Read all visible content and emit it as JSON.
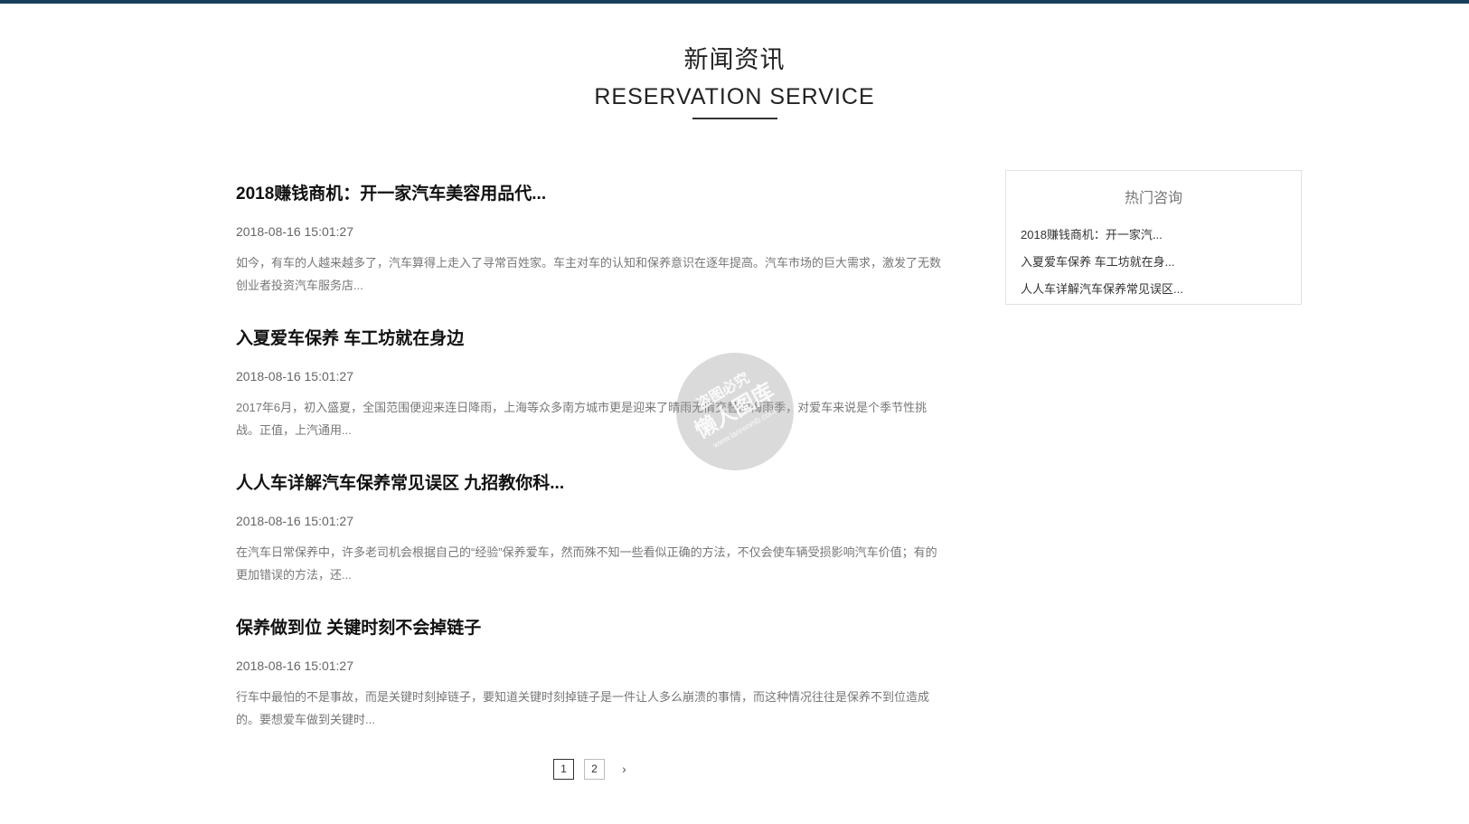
{
  "header": {
    "title": "新闻资讯",
    "subtitle": "RESERVATION SERVICE"
  },
  "news": [
    {
      "title": "2018赚钱商机：开一家汽车美容用品代...",
      "date": "2018-08-16 15:01:27",
      "summary_line1": "如今，有车的人越来越多了，汽车算得上走入了寻常百姓家。车主对车的认知和保养意识在逐年提高。汽车市场的巨大需求，激发了无数",
      "summary_line2": "创业者投资汽车服务店..."
    },
    {
      "title": "入夏爱车保养 车工坊就在身边",
      "date": "2018-08-16 15:01:27",
      "summary_line1": "2017年6月，初入盛夏，全国范围便迎来连日降雨，上海等众多南方城市更是迎来了晴雨无情交替的梅雨季，对爱车来说是个季节性挑",
      "summary_line2": "战。正值，上汽通用..."
    },
    {
      "title": "人人车详解汽车保养常见误区 九招教你科...",
      "date": "2018-08-16 15:01:27",
      "summary_line1": "在汽车日常保养中，许多老司机会根据自己的“经验”保养爱车，然而殊不知一些看似正确的方法，不仅会使车辆受损影响汽车价值；有的",
      "summary_line2": "更加错误的方法，还..."
    },
    {
      "title": "保养做到位 关键时刻不会掉链子",
      "date": "2018-08-16 15:01:27",
      "summary_line1": "行车中最怕的不是事故，而是关键时刻掉链子，要知道关键时刻掉链子是一件让人多么崩溃的事情，而这种情况往往是保养不到位造成",
      "summary_line2": "的。要想爱车做到关键时..."
    }
  ],
  "pagination": {
    "pages": [
      "1",
      "2"
    ],
    "current": "1",
    "next_icon": "chevron-right-icon",
    "next_glyph": "›"
  },
  "sidebar": {
    "title": "热门咨询",
    "items": [
      "2018赚钱商机：开一家汽...",
      "入夏爱车保养 车工坊就在身...",
      "人人车详解汽车保养常见误区..."
    ]
  },
  "watermark": {
    "line1": "盗图必究",
    "line2": "懒人图库",
    "line3": "www.lanrenmb.com"
  },
  "colors": {
    "top_bar": "#163f5c"
  }
}
